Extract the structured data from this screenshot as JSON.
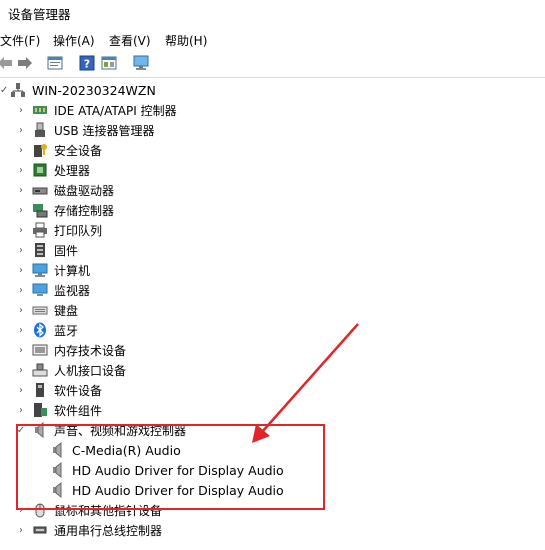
{
  "window": {
    "title": "设备管理器"
  },
  "menu": [
    {
      "label": "文件(F)"
    },
    {
      "label": "操作(A)"
    },
    {
      "label": "查看(V)"
    },
    {
      "label": "帮助(H)"
    }
  ],
  "toolbar": {
    "icons": [
      "back-icon",
      "forward-icon",
      "properties-icon",
      "help-icon",
      "view-icon",
      "monitor-scan-icon"
    ]
  },
  "tree": {
    "root": "WIN-20230324WZN",
    "categories": [
      {
        "label": "IDE ATA/ATAPI 控制器",
        "icon": "ide-icon"
      },
      {
        "label": "USB 连接器管理器",
        "icon": "usb-icon"
      },
      {
        "label": "安全设备",
        "icon": "security-icon"
      },
      {
        "label": "处理器",
        "icon": "cpu-icon"
      },
      {
        "label": "磁盘驱动器",
        "icon": "disk-icon"
      },
      {
        "label": "存储控制器",
        "icon": "storage-icon"
      },
      {
        "label": "打印队列",
        "icon": "printer-icon"
      },
      {
        "label": "固件",
        "icon": "firmware-icon"
      },
      {
        "label": "计算机",
        "icon": "computer-icon"
      },
      {
        "label": "监视器",
        "icon": "monitor-icon"
      },
      {
        "label": "键盘",
        "icon": "keyboard-icon"
      },
      {
        "label": "蓝牙",
        "icon": "bluetooth-icon"
      },
      {
        "label": "内存技术设备",
        "icon": "memory-icon"
      },
      {
        "label": "人机接口设备",
        "icon": "hid-icon"
      },
      {
        "label": "软件设备",
        "icon": "software-device-icon"
      },
      {
        "label": "软件组件",
        "icon": "software-component-icon"
      },
      {
        "label": "声音、视频和游戏控制器",
        "icon": "speaker-icon",
        "expanded": true
      },
      {
        "label": "鼠标和其他指针设备",
        "icon": "mouse-icon"
      },
      {
        "label": "通用串行总线控制器",
        "icon": "usb-controller-icon"
      }
    ],
    "audio_children": [
      {
        "label": "C-Media(R) Audio"
      },
      {
        "label": "HD Audio Driver for Display Audio"
      },
      {
        "label": "HD Audio Driver for Display Audio"
      }
    ]
  },
  "colors": {
    "highlight_box": "#e0262a",
    "arrow": "#e0262a"
  }
}
